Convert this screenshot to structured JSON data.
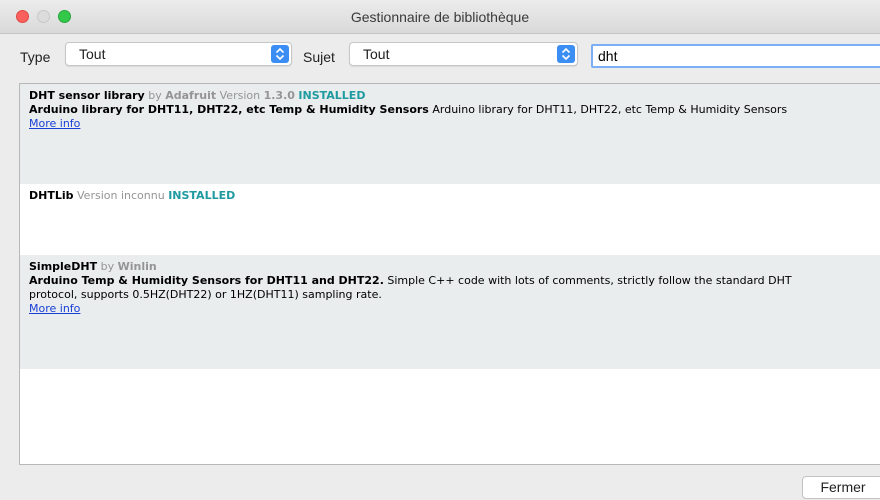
{
  "window": {
    "title": "Gestionnaire de bibliothèque"
  },
  "filters": {
    "type_label": "Type",
    "type_value": "Tout",
    "topic_label": "Sujet",
    "topic_value": "Tout",
    "search_value": "dht"
  },
  "libraries": [
    {
      "name": "DHT sensor library",
      "by_word": "by",
      "author": "Adafruit",
      "version_word": "Version",
      "version": "1.3.0",
      "status": "INSTALLED",
      "sentence": "Arduino library for DHT11, DHT22, etc Temp & Humidity Sensors",
      "paragraph": "Arduino library for DHT11, DHT22, etc Temp & Humidity Sensors",
      "more_info": "More info"
    },
    {
      "name": "DHTLib",
      "version_word": "Version",
      "version": "inconnu",
      "status": "INSTALLED"
    },
    {
      "name": "SimpleDHT",
      "by_word": "by",
      "author": "Winlin",
      "sentence": "Arduino Temp & Humidity Sensors for DHT11 and DHT22.",
      "paragraph_line1": "Simple C++ code with lots of comments, strictly follow the standard DHT",
      "paragraph_line2": "protocol, supports 0.5HZ(DHT22) or 1HZ(DHT11) sampling rate.",
      "more_info": "More info"
    }
  ],
  "footer": {
    "close_label": "Fermer"
  }
}
